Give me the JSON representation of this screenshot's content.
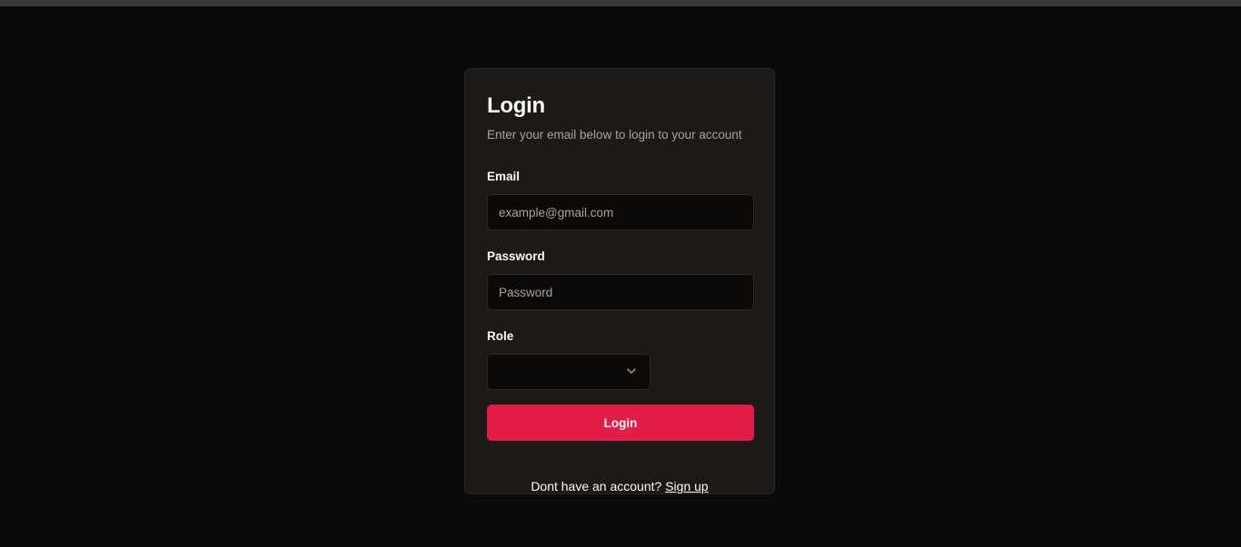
{
  "login": {
    "title": "Login",
    "subtitle": "Enter your email below to login to your account",
    "email": {
      "label": "Email",
      "placeholder": "example@gmail.com",
      "value": ""
    },
    "password": {
      "label": "Password",
      "placeholder": "Password",
      "value": ""
    },
    "role": {
      "label": "Role",
      "selected": ""
    },
    "submit_label": "Login",
    "footer": {
      "prompt": "Dont have an account? ",
      "link": "Sign up"
    }
  },
  "colors": {
    "background": "#0b0a0a",
    "card": "#1c1917",
    "accent": "#e11d48",
    "muted_text": "#a8a29e"
  },
  "icons": {
    "role_select": "chevron-down-icon"
  }
}
